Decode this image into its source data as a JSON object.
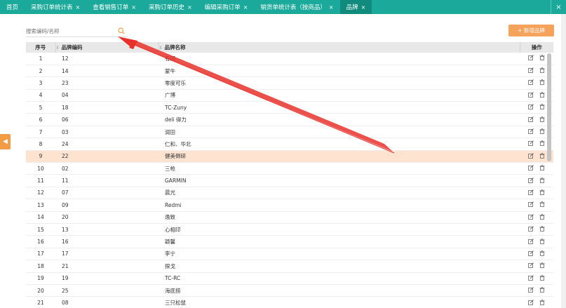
{
  "tabs": [
    {
      "label": "首页",
      "closable": false,
      "active": false
    },
    {
      "label": "采购订单统计表",
      "closable": true,
      "active": false
    },
    {
      "label": "查看销售订单",
      "closable": true,
      "active": false
    },
    {
      "label": "采购订单历史",
      "closable": true,
      "active": false
    },
    {
      "label": "编辑采购订单",
      "closable": true,
      "active": false
    },
    {
      "label": "销货单统计表（按商品）",
      "closable": true,
      "active": false
    },
    {
      "label": "品牌",
      "closable": true,
      "active": true
    }
  ],
  "tab_close_glyph": "×",
  "search": {
    "placeholder": "搜索编码/名称",
    "value": ""
  },
  "add_button": {
    "label": "+ 新增品牌"
  },
  "table": {
    "headers": {
      "index": "序号",
      "code": "品牌编码",
      "name": "品牌名称",
      "ops": "操作"
    },
    "rows": [
      {
        "index": "1",
        "code": "12",
        "name": "有田"
      },
      {
        "index": "2",
        "code": "14",
        "name": "蒙牛"
      },
      {
        "index": "3",
        "code": "23",
        "name": "零度可乐"
      },
      {
        "index": "4",
        "code": "04",
        "name": "广博"
      },
      {
        "index": "5",
        "code": "18",
        "name": "TC-Zuny"
      },
      {
        "index": "6",
        "code": "06",
        "name": "deli 得力"
      },
      {
        "index": "7",
        "code": "03",
        "name": "润田"
      },
      {
        "index": "8",
        "code": "24",
        "name": "仁和、华北"
      },
      {
        "index": "9",
        "code": "22",
        "name": "健美倒研",
        "highlighted": true
      },
      {
        "index": "10",
        "code": "02",
        "name": "三枪"
      },
      {
        "index": "11",
        "code": "11",
        "name": "GARMIN"
      },
      {
        "index": "12",
        "code": "07",
        "name": "晨光"
      },
      {
        "index": "13",
        "code": "09",
        "name": "Redmi"
      },
      {
        "index": "14",
        "code": "20",
        "name": "逸致"
      },
      {
        "index": "15",
        "code": "13",
        "name": "心相印"
      },
      {
        "index": "16",
        "code": "16",
        "name": "颖馨"
      },
      {
        "index": "17",
        "code": "17",
        "name": "李宁"
      },
      {
        "index": "18",
        "code": "21",
        "name": "探戈"
      },
      {
        "index": "19",
        "code": "19",
        "name": "TC-RC"
      },
      {
        "index": "20",
        "code": "25",
        "name": "海底捞"
      },
      {
        "index": "21",
        "code": "08",
        "name": "三只松鼠"
      }
    ]
  },
  "colors": {
    "tabbar": "#1aa99a",
    "accent": "#f5a25a",
    "highlight_row": "#fde3d0",
    "annotation": "#e8312a"
  }
}
